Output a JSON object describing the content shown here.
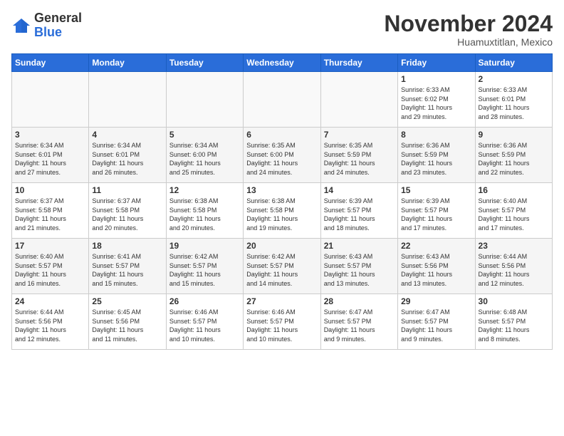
{
  "logo": {
    "general": "General",
    "blue": "Blue"
  },
  "header": {
    "month_title": "November 2024",
    "location": "Huamuxtitlan, Mexico"
  },
  "weekdays": [
    "Sunday",
    "Monday",
    "Tuesday",
    "Wednesday",
    "Thursday",
    "Friday",
    "Saturday"
  ],
  "weeks": [
    [
      {
        "day": "",
        "info": ""
      },
      {
        "day": "",
        "info": ""
      },
      {
        "day": "",
        "info": ""
      },
      {
        "day": "",
        "info": ""
      },
      {
        "day": "",
        "info": ""
      },
      {
        "day": "1",
        "info": "Sunrise: 6:33 AM\nSunset: 6:02 PM\nDaylight: 11 hours\nand 29 minutes."
      },
      {
        "day": "2",
        "info": "Sunrise: 6:33 AM\nSunset: 6:01 PM\nDaylight: 11 hours\nand 28 minutes."
      }
    ],
    [
      {
        "day": "3",
        "info": "Sunrise: 6:34 AM\nSunset: 6:01 PM\nDaylight: 11 hours\nand 27 minutes."
      },
      {
        "day": "4",
        "info": "Sunrise: 6:34 AM\nSunset: 6:01 PM\nDaylight: 11 hours\nand 26 minutes."
      },
      {
        "day": "5",
        "info": "Sunrise: 6:34 AM\nSunset: 6:00 PM\nDaylight: 11 hours\nand 25 minutes."
      },
      {
        "day": "6",
        "info": "Sunrise: 6:35 AM\nSunset: 6:00 PM\nDaylight: 11 hours\nand 24 minutes."
      },
      {
        "day": "7",
        "info": "Sunrise: 6:35 AM\nSunset: 5:59 PM\nDaylight: 11 hours\nand 24 minutes."
      },
      {
        "day": "8",
        "info": "Sunrise: 6:36 AM\nSunset: 5:59 PM\nDaylight: 11 hours\nand 23 minutes."
      },
      {
        "day": "9",
        "info": "Sunrise: 6:36 AM\nSunset: 5:59 PM\nDaylight: 11 hours\nand 22 minutes."
      }
    ],
    [
      {
        "day": "10",
        "info": "Sunrise: 6:37 AM\nSunset: 5:58 PM\nDaylight: 11 hours\nand 21 minutes."
      },
      {
        "day": "11",
        "info": "Sunrise: 6:37 AM\nSunset: 5:58 PM\nDaylight: 11 hours\nand 20 minutes."
      },
      {
        "day": "12",
        "info": "Sunrise: 6:38 AM\nSunset: 5:58 PM\nDaylight: 11 hours\nand 20 minutes."
      },
      {
        "day": "13",
        "info": "Sunrise: 6:38 AM\nSunset: 5:58 PM\nDaylight: 11 hours\nand 19 minutes."
      },
      {
        "day": "14",
        "info": "Sunrise: 6:39 AM\nSunset: 5:57 PM\nDaylight: 11 hours\nand 18 minutes."
      },
      {
        "day": "15",
        "info": "Sunrise: 6:39 AM\nSunset: 5:57 PM\nDaylight: 11 hours\nand 17 minutes."
      },
      {
        "day": "16",
        "info": "Sunrise: 6:40 AM\nSunset: 5:57 PM\nDaylight: 11 hours\nand 17 minutes."
      }
    ],
    [
      {
        "day": "17",
        "info": "Sunrise: 6:40 AM\nSunset: 5:57 PM\nDaylight: 11 hours\nand 16 minutes."
      },
      {
        "day": "18",
        "info": "Sunrise: 6:41 AM\nSunset: 5:57 PM\nDaylight: 11 hours\nand 15 minutes."
      },
      {
        "day": "19",
        "info": "Sunrise: 6:42 AM\nSunset: 5:57 PM\nDaylight: 11 hours\nand 15 minutes."
      },
      {
        "day": "20",
        "info": "Sunrise: 6:42 AM\nSunset: 5:57 PM\nDaylight: 11 hours\nand 14 minutes."
      },
      {
        "day": "21",
        "info": "Sunrise: 6:43 AM\nSunset: 5:57 PM\nDaylight: 11 hours\nand 13 minutes."
      },
      {
        "day": "22",
        "info": "Sunrise: 6:43 AM\nSunset: 5:56 PM\nDaylight: 11 hours\nand 13 minutes."
      },
      {
        "day": "23",
        "info": "Sunrise: 6:44 AM\nSunset: 5:56 PM\nDaylight: 11 hours\nand 12 minutes."
      }
    ],
    [
      {
        "day": "24",
        "info": "Sunrise: 6:44 AM\nSunset: 5:56 PM\nDaylight: 11 hours\nand 12 minutes."
      },
      {
        "day": "25",
        "info": "Sunrise: 6:45 AM\nSunset: 5:56 PM\nDaylight: 11 hours\nand 11 minutes."
      },
      {
        "day": "26",
        "info": "Sunrise: 6:46 AM\nSunset: 5:57 PM\nDaylight: 11 hours\nand 10 minutes."
      },
      {
        "day": "27",
        "info": "Sunrise: 6:46 AM\nSunset: 5:57 PM\nDaylight: 11 hours\nand 10 minutes."
      },
      {
        "day": "28",
        "info": "Sunrise: 6:47 AM\nSunset: 5:57 PM\nDaylight: 11 hours\nand 9 minutes."
      },
      {
        "day": "29",
        "info": "Sunrise: 6:47 AM\nSunset: 5:57 PM\nDaylight: 11 hours\nand 9 minutes."
      },
      {
        "day": "30",
        "info": "Sunrise: 6:48 AM\nSunset: 5:57 PM\nDaylight: 11 hours\nand 8 minutes."
      }
    ]
  ]
}
